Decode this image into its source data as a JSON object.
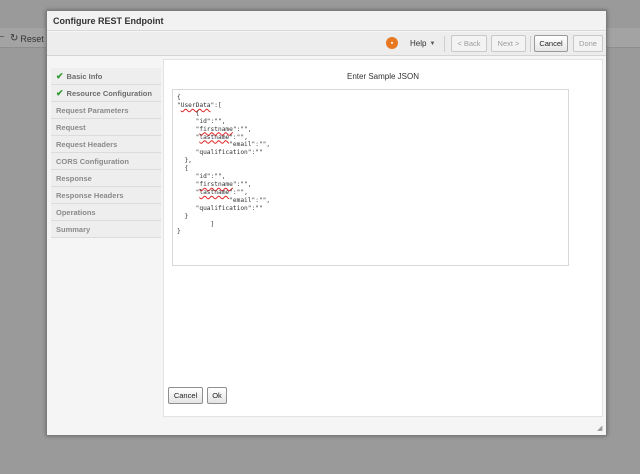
{
  "background": {
    "reset_label": "Reset"
  },
  "dialog": {
    "title": "Configure REST Endpoint"
  },
  "toolbar": {
    "help_label": "Help",
    "back_label": "< Back",
    "next_label": "Next >",
    "cancel_label": "Cancel",
    "done_label": "Done"
  },
  "nav": {
    "items": [
      {
        "label": "Basic Info",
        "completed": true
      },
      {
        "label": "Resource Configuration",
        "completed": true
      },
      {
        "label": "Request Parameters",
        "completed": false
      },
      {
        "label": "Request",
        "completed": false
      },
      {
        "label": "Request Headers",
        "completed": false
      },
      {
        "label": "CORS Configuration",
        "completed": false
      },
      {
        "label": "Response",
        "completed": false
      },
      {
        "label": "Response Headers",
        "completed": false
      },
      {
        "label": "Operations",
        "completed": false
      },
      {
        "label": "Summary",
        "completed": false
      }
    ]
  },
  "panel": {
    "title": "Enter Sample JSON",
    "json_lines": [
      "{",
      "\"UserData\":[",
      "     {",
      "     \"id\":\"\",",
      "     \"firstname\":\"\",",
      "     \"lastname\":\"\",",
      "              \"email\":\"\",",
      "     \"qualification\":\"\"",
      "  },",
      "  {",
      "     \"id\":\"\",",
      "     \"firstname\":\"\",",
      "     \"lastname\":\"\",",
      "              \"email\":\"\",",
      "     \"qualification\":\"\"",
      "  }",
      "         ]",
      "}"
    ],
    "cancel_label": "Cancel",
    "ok_label": "Ok"
  },
  "colors": {
    "accent_orange": "#e87722",
    "check_green": "#2e9b2e"
  }
}
